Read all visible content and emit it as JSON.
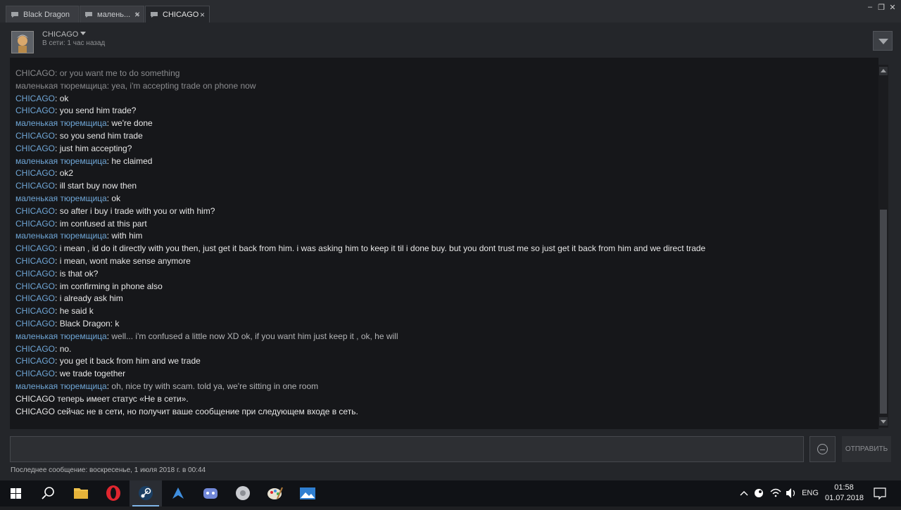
{
  "tabs": [
    {
      "label": "Black Dragon"
    },
    {
      "label": "малень..."
    },
    {
      "label": "CHICAGO"
    }
  ],
  "tab_close_glyph": "×",
  "window_controls": {
    "minimize": "–",
    "restore": "❐",
    "close": "✕"
  },
  "contact": {
    "name": "CHICAGO",
    "status": "В сети: 1 час назад"
  },
  "messages": [
    {
      "name": "CHICAGO",
      "sep": ": ",
      "text": "or you want me to do something",
      "who": "me",
      "old": true
    },
    {
      "name": "маленькая тюремщица",
      "sep": ": ",
      "text": "yea, i'm accepting trade on phone now",
      "who": "them",
      "old": true
    },
    {
      "name": "CHICAGO",
      "sep": ": ",
      "text": "ok",
      "who": "me"
    },
    {
      "name": "CHICAGO",
      "sep": ": ",
      "text": "you send him trade?",
      "who": "me"
    },
    {
      "name": "маленькая тюремщица",
      "sep": ": ",
      "text": "we're done",
      "who": "them"
    },
    {
      "name": "CHICAGO",
      "sep": ": ",
      "text": "so you send him trade",
      "who": "me"
    },
    {
      "name": "CHICAGO",
      "sep": ": ",
      "text": "just him accepting?",
      "who": "me"
    },
    {
      "name": "маленькая тюремщица",
      "sep": ": ",
      "text": "he claimed",
      "who": "them"
    },
    {
      "name": "CHICAGO",
      "sep": ": ",
      "text": "ok2",
      "who": "me"
    },
    {
      "name": "CHICAGO",
      "sep": ": ",
      "text": "ill start buy now then",
      "who": "me"
    },
    {
      "name": "маленькая тюремщица",
      "sep": ": ",
      "text": "ok",
      "who": "them"
    },
    {
      "name": "CHICAGO",
      "sep": ": ",
      "text": "so after i buy i trade with you or with him?",
      "who": "me"
    },
    {
      "name": "CHICAGO",
      "sep": ": ",
      "text": "im confused at this part",
      "who": "me"
    },
    {
      "name": "маленькая тюремщица",
      "sep": ": ",
      "text": "with him",
      "who": "them"
    },
    {
      "name": "CHICAGO",
      "sep": ": ",
      "text": "i mean , id do it directly with you then, just get it  back from him.  i was asking him to keep it til i done buy. but you dont trust me so just  get it back from him and we direct trade",
      "who": "me"
    },
    {
      "name": "CHICAGO",
      "sep": ": ",
      "text": "i mean, wont make sense anymore",
      "who": "me"
    },
    {
      "name": "CHICAGO",
      "sep": ": ",
      "text": "is that ok?",
      "who": "me"
    },
    {
      "name": "CHICAGO",
      "sep": ": ",
      "text": "im confirming in phone also",
      "who": "me"
    },
    {
      "name": "CHICAGO",
      "sep": ": ",
      "text": "i already ask him",
      "who": "me"
    },
    {
      "name": "CHICAGO",
      "sep": ": ",
      "text": "he said k",
      "who": "me"
    },
    {
      "name": "CHICAGO",
      "sep": ": ",
      "text": "Black Dragon: k",
      "who": "me"
    },
    {
      "name": "маленькая тюремщица",
      "sep": ": ",
      "text": "well... i'm confused a little now XD ok, if you want him just keep it , ok, he will",
      "who": "them",
      "dim": true
    },
    {
      "name": "CHICAGO",
      "sep": ": ",
      "text": "no.",
      "who": "me"
    },
    {
      "name": "CHICAGO",
      "sep": ": ",
      "text": "you get it back from him and we trade",
      "who": "me"
    },
    {
      "name": "CHICAGO",
      "sep": ": ",
      "text": "we trade together",
      "who": "me"
    },
    {
      "name": "маленькая тюремщица",
      "sep": ": ",
      "text": "oh, nice try with scam. told ya, we're sitting in one room",
      "who": "them",
      "dim": true
    }
  ],
  "system_messages": [
    "CHICAGO теперь имеет статус «Не в сети».",
    "CHICAGO сейчас не в сети, но получит ваше сообщение при следующем входе в сеть."
  ],
  "composer": {
    "send_label": "ОТПРАВИТЬ",
    "emoji_icon": "emoticon-icon"
  },
  "footer": {
    "last_message": "Последнее сообщение: воскресенье, 1 июля 2018 г. в 00:44"
  },
  "taskbar": {
    "items": [
      {
        "name": "start-button",
        "icon": "windows-logo-icon"
      },
      {
        "name": "search-button",
        "icon": "search-icon"
      },
      {
        "name": "taskbar-file-explorer",
        "icon": "folder-icon"
      },
      {
        "name": "taskbar-opera",
        "icon": "opera-icon"
      },
      {
        "name": "taskbar-steam",
        "icon": "steam-icon",
        "active": true
      },
      {
        "name": "taskbar-app-blue",
        "icon": "app-icon"
      },
      {
        "name": "taskbar-discord",
        "icon": "discord-icon"
      },
      {
        "name": "taskbar-app-white",
        "icon": "app-icon"
      },
      {
        "name": "taskbar-paint",
        "icon": "paint-icon"
      },
      {
        "name": "taskbar-photos",
        "icon": "photos-icon"
      }
    ],
    "tray": {
      "language": "ENG",
      "time": "01:58",
      "date": "01.07.2018"
    }
  },
  "colors": {
    "name_link": "#6fa6d6",
    "message_text": "#e7e7e7",
    "accent_taskbar": "#7fb4e6"
  }
}
